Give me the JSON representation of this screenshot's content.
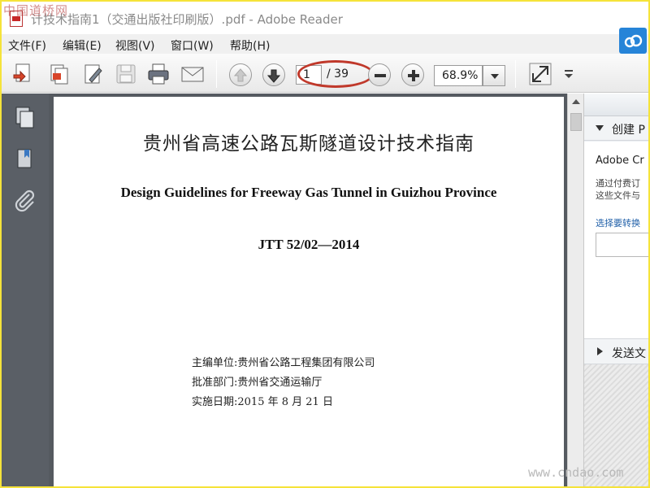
{
  "window": {
    "title": "计技术指南1（交通出版社印刷版）.pdf - Adobe Reader",
    "watermark_top": "中国道桥网"
  },
  "menu": {
    "items": [
      {
        "label": "文件(F)"
      },
      {
        "label": "编辑(E)"
      },
      {
        "label": "视图(V)"
      },
      {
        "label": "窗口(W)"
      },
      {
        "label": "帮助(H)"
      }
    ]
  },
  "toolbar": {
    "page_current": "1",
    "page_total": "/ 39",
    "zoom": "68.9%"
  },
  "document": {
    "title_cn": "贵州省高速公路瓦斯隧道设计技术指南",
    "title_en": "Design Guidelines for Freeway Gas Tunnel in Guizhou Province",
    "code": "JTT  52/02—2014",
    "editor": "主编单位:贵州省公路工程集团有限公司",
    "approver": "批准部门:贵州省交通运输厅",
    "date": "实施日期:2015 年 8 月 21 日"
  },
  "right_pane": {
    "create_header": "创建 P",
    "brand": "Adobe Cr",
    "desc_line1": "通过付费订",
    "desc_line2": "这些文件与",
    "select_label": "选择要转换",
    "send_header": "发送文"
  },
  "watermark_bottom": "www.cndao.com",
  "colors": {
    "frame_border": "#f5e33a",
    "highlight_ellipse": "#c0392b",
    "left_pane": "#5a5f66",
    "cloud_button": "#2684d8"
  }
}
